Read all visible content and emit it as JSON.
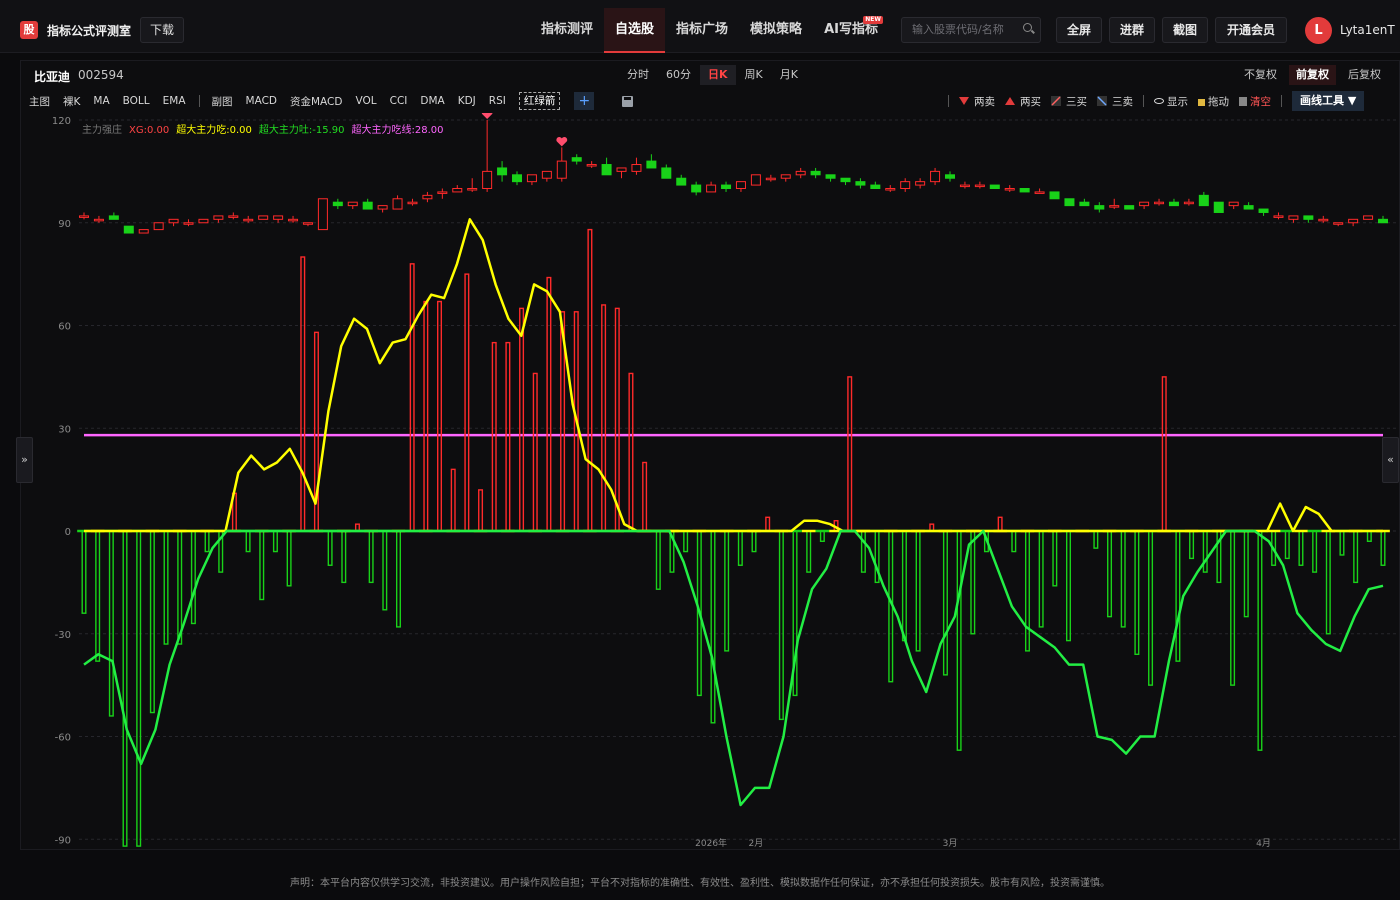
{
  "app": {
    "logo_char": "股",
    "title": "指标公式评测室",
    "download": "下载"
  },
  "nav": [
    {
      "label": "指标测评",
      "active": false
    },
    {
      "label": "自选股",
      "active": true
    },
    {
      "label": "指标广场",
      "active": false
    },
    {
      "label": "模拟策略",
      "active": false
    },
    {
      "label": "AI写指标",
      "active": false,
      "badge": "NEW"
    }
  ],
  "search": {
    "placeholder": "输入股票代码/名称"
  },
  "top_buttons": {
    "fullscreen": "全屏",
    "join": "进群",
    "screenshot": "截图",
    "vip": "开通会员"
  },
  "user": {
    "initial": "L",
    "name": "Lyta1enT"
  },
  "stock": {
    "name": "比亚迪",
    "code": "002594"
  },
  "periods": [
    {
      "label": "分时",
      "active": false
    },
    {
      "label": "60分",
      "active": false
    },
    {
      "label": "日K",
      "active": true
    },
    {
      "label": "周K",
      "active": false
    },
    {
      "label": "月K",
      "active": false
    }
  ],
  "adjust": [
    {
      "label": "不复权",
      "active": false
    },
    {
      "label": "前复权",
      "active": true
    },
    {
      "label": "后复权",
      "active": false
    }
  ],
  "indicators_main": [
    "主图",
    "裸K",
    "MA",
    "BOLL",
    "EMA"
  ],
  "indicators_sub": [
    "副图",
    "MACD",
    "资金MACD",
    "VOL",
    "CCI",
    "DMA",
    "KDJ",
    "RSI"
  ],
  "indicator_selected": "红绿箭",
  "tools": {
    "two_sell": "两卖",
    "two_buy": "两买",
    "three_buy": "三买",
    "three_sell": "三卖",
    "show": "显示",
    "drag": "拖动",
    "clear": "清空",
    "draw_tools": "画线工具 ▼"
  },
  "legend": [
    {
      "text": "主力强庄",
      "color": "#777777"
    },
    {
      "text": "XG:0.00",
      "color": "#ff4444"
    },
    {
      "text": "超大主力吃:0.00",
      "color": "#ffff00"
    },
    {
      "text": "超大主力吐:-15.90",
      "color": "#22dd22"
    },
    {
      "text": "超大主力吃线:28.00",
      "color": "#ff66ff"
    }
  ],
  "colors": {
    "up": "#ff2a2a",
    "down": "#19d219",
    "yellow": "#ffff00",
    "green_line": "#22ee44",
    "magenta": "#ff66ff"
  },
  "chart_data": {
    "type": "bar",
    "ylim": [
      -92,
      120
    ],
    "y_ticks": [
      120,
      90,
      60,
      30,
      0,
      -30,
      -60,
      -90
    ],
    "x_labels": [
      {
        "text": "2026年",
        "index": 42
      },
      {
        "text": "2月",
        "index": 45
      },
      {
        "text": "3月",
        "index": 58
      },
      {
        "text": "4月",
        "index": 79
      }
    ],
    "ref_line": 28,
    "marker_bars": [
      27,
      32
    ],
    "candles": [
      [
        92,
        93,
        91,
        92
      ],
      [
        91,
        92,
        90,
        91
      ],
      [
        92,
        93,
        91,
        91
      ],
      [
        89,
        89,
        87,
        87
      ],
      [
        87,
        88,
        87,
        88
      ],
      [
        88,
        90,
        88,
        90
      ],
      [
        90,
        91,
        89,
        91
      ],
      [
        90,
        91,
        89,
        90
      ],
      [
        90,
        91,
        90,
        91
      ],
      [
        91,
        92,
        90,
        92
      ],
      [
        92,
        93,
        91,
        92
      ],
      [
        91,
        92,
        90,
        91
      ],
      [
        91,
        92,
        91,
        92
      ],
      [
        91,
        92,
        90,
        92
      ],
      [
        91,
        92,
        90,
        91
      ],
      [
        90,
        90,
        89,
        90
      ],
      [
        88,
        97,
        88,
        97
      ],
      [
        96,
        97,
        94,
        95
      ],
      [
        95,
        96,
        94,
        96
      ],
      [
        96,
        97,
        94,
        94
      ],
      [
        94,
        95,
        93,
        95
      ],
      [
        94,
        98,
        94,
        97
      ],
      [
        96,
        97,
        95,
        96
      ],
      [
        97,
        99,
        96,
        98
      ],
      [
        99,
        100,
        97,
        99
      ],
      [
        99,
        101,
        99,
        100
      ],
      [
        100,
        103,
        99,
        100
      ],
      [
        100,
        120,
        99,
        105
      ],
      [
        106,
        108,
        102,
        104
      ],
      [
        104,
        105,
        101,
        102
      ],
      [
        102,
        104,
        101,
        104
      ],
      [
        103,
        105,
        102,
        105
      ],
      [
        103,
        112,
        102,
        108
      ],
      [
        109,
        110,
        107,
        108
      ],
      [
        107,
        108,
        106,
        107
      ],
      [
        107,
        109,
        104,
        104
      ],
      [
        105,
        106,
        103,
        106
      ],
      [
        105,
        109,
        104,
        107
      ],
      [
        108,
        110,
        106,
        106
      ],
      [
        106,
        107,
        103,
        103
      ],
      [
        103,
        104,
        101,
        101
      ],
      [
        101,
        102,
        98,
        99
      ],
      [
        99,
        102,
        99,
        101
      ],
      [
        101,
        102,
        99,
        100
      ],
      [
        100,
        102,
        99,
        102
      ],
      [
        101,
        104,
        101,
        104
      ],
      [
        103,
        104,
        102,
        103
      ],
      [
        103,
        104,
        102,
        104
      ],
      [
        104,
        106,
        103,
        105
      ],
      [
        105,
        106,
        103,
        104
      ],
      [
        104,
        104,
        102,
        103
      ],
      [
        103,
        103,
        101,
        102
      ],
      [
        102,
        103,
        100,
        101
      ],
      [
        101,
        102,
        100,
        100
      ],
      [
        100,
        101,
        99,
        100
      ],
      [
        100,
        103,
        99,
        102
      ],
      [
        101,
        103,
        100,
        102
      ],
      [
        102,
        106,
        101,
        105
      ],
      [
        104,
        105,
        102,
        103
      ],
      [
        101,
        102,
        100,
        101
      ],
      [
        101,
        102,
        100,
        101
      ],
      [
        101,
        101,
        100,
        100
      ],
      [
        100,
        101,
        99,
        100
      ],
      [
        100,
        100,
        99,
        99
      ],
      [
        99,
        100,
        99,
        99
      ],
      [
        99,
        99,
        97,
        97
      ],
      [
        97,
        97,
        95,
        95
      ],
      [
        96,
        97,
        95,
        95
      ],
      [
        95,
        96,
        93,
        94
      ],
      [
        95,
        97,
        94,
        95
      ],
      [
        95,
        95,
        94,
        94
      ],
      [
        95,
        96,
        94,
        96
      ],
      [
        96,
        97,
        95,
        96
      ],
      [
        96,
        97,
        95,
        95
      ],
      [
        96,
        97,
        95,
        96
      ],
      [
        98,
        99,
        95,
        95
      ],
      [
        96,
        96,
        93,
        93
      ],
      [
        95,
        96,
        94,
        96
      ],
      [
        95,
        96,
        94,
        94
      ],
      [
        94,
        94,
        92,
        93
      ],
      [
        92,
        93,
        91,
        92
      ],
      [
        91,
        92,
        90,
        92
      ],
      [
        92,
        92,
        90,
        91
      ],
      [
        91,
        92,
        90,
        91
      ],
      [
        90,
        90,
        89,
        90
      ],
      [
        90,
        91,
        89,
        91
      ],
      [
        91,
        92,
        91,
        92
      ],
      [
        91,
        92,
        90,
        90
      ]
    ],
    "bars": [
      -24,
      -38,
      -54,
      -92,
      -92,
      -53,
      -33,
      -33,
      -27,
      -6,
      -12,
      11,
      -6,
      -20,
      -6,
      -16,
      80,
      58,
      -10,
      -15,
      2,
      -15,
      -23,
      -28,
      78,
      67,
      67,
      18,
      75,
      12,
      55,
      55,
      65,
      46,
      74,
      64,
      64,
      88,
      66,
      65,
      46,
      20,
      -17,
      -12,
      -6,
      -48,
      -56,
      -35,
      -10,
      -6,
      4,
      -55,
      -48,
      -12,
      -3,
      3,
      45,
      -12,
      -15,
      -44,
      -32,
      -35,
      2,
      -42,
      -64,
      -30,
      -6,
      4,
      -6,
      -35,
      -28,
      -16,
      -32,
      0,
      -5,
      -25,
      -28,
      -36,
      -45,
      45,
      -38,
      -8,
      -12,
      -15,
      -45,
      -25,
      -64,
      -10,
      -8,
      -10,
      -12,
      -30,
      -7,
      -15,
      -3,
      -10
    ],
    "yellow_line": [
      0,
      0,
      0,
      0,
      0,
      0,
      0,
      0,
      0,
      0,
      0,
      0,
      17,
      22,
      18,
      20,
      24,
      17,
      8,
      35,
      54,
      62,
      59,
      49,
      55,
      56,
      63,
      69,
      68,
      78,
      91,
      85,
      72,
      62,
      57,
      72,
      70,
      64,
      37,
      21,
      18,
      12,
      2,
      0,
      0,
      0,
      0,
      0,
      0,
      0,
      0,
      0,
      0,
      0,
      0,
      0,
      3,
      3,
      2,
      0,
      0,
      0,
      0,
      0,
      0,
      0,
      0,
      0,
      0,
      0,
      0,
      0,
      0,
      0,
      0,
      0,
      0,
      0,
      0,
      0,
      0,
      0,
      0,
      0,
      0,
      0,
      0,
      0,
      0,
      0,
      0,
      0,
      0,
      8,
      0,
      7,
      5,
      0,
      0,
      0,
      0,
      0
    ],
    "green_line": [
      -39,
      -36,
      -38,
      -58,
      -68,
      -58,
      -39,
      -27,
      -14,
      -5,
      0,
      0,
      0,
      0,
      0,
      0,
      0,
      0,
      0,
      0,
      0,
      0,
      0,
      0,
      0,
      0,
      0,
      0,
      0,
      0,
      0,
      0,
      0,
      0,
      0,
      0,
      0,
      0,
      0,
      0,
      0,
      0,
      -9,
      -22,
      -37,
      -60,
      -80,
      -75,
      -75,
      -60,
      -32,
      -17,
      -11,
      0,
      0,
      -5,
      -16,
      -25,
      -38,
      -47,
      -33,
      -25,
      -4,
      0,
      -11,
      -22,
      -28,
      -31,
      -34,
      -39,
      -39,
      -60,
      -61,
      -65,
      -60,
      -60,
      -38,
      -19,
      -12,
      -6,
      0,
      0,
      0,
      -3,
      -10,
      -24,
      -29,
      -33,
      -35,
      -25,
      -17,
      -16
    ]
  },
  "disclaimer": "声明：本平台内容仅供学习交流，非投资建议。用户操作风险自担；平台不对指标的准确性、有效性、盈利性、模拟数据作任何保证，亦不承担任何投资损失。股市有风险，投资需谨慎。"
}
